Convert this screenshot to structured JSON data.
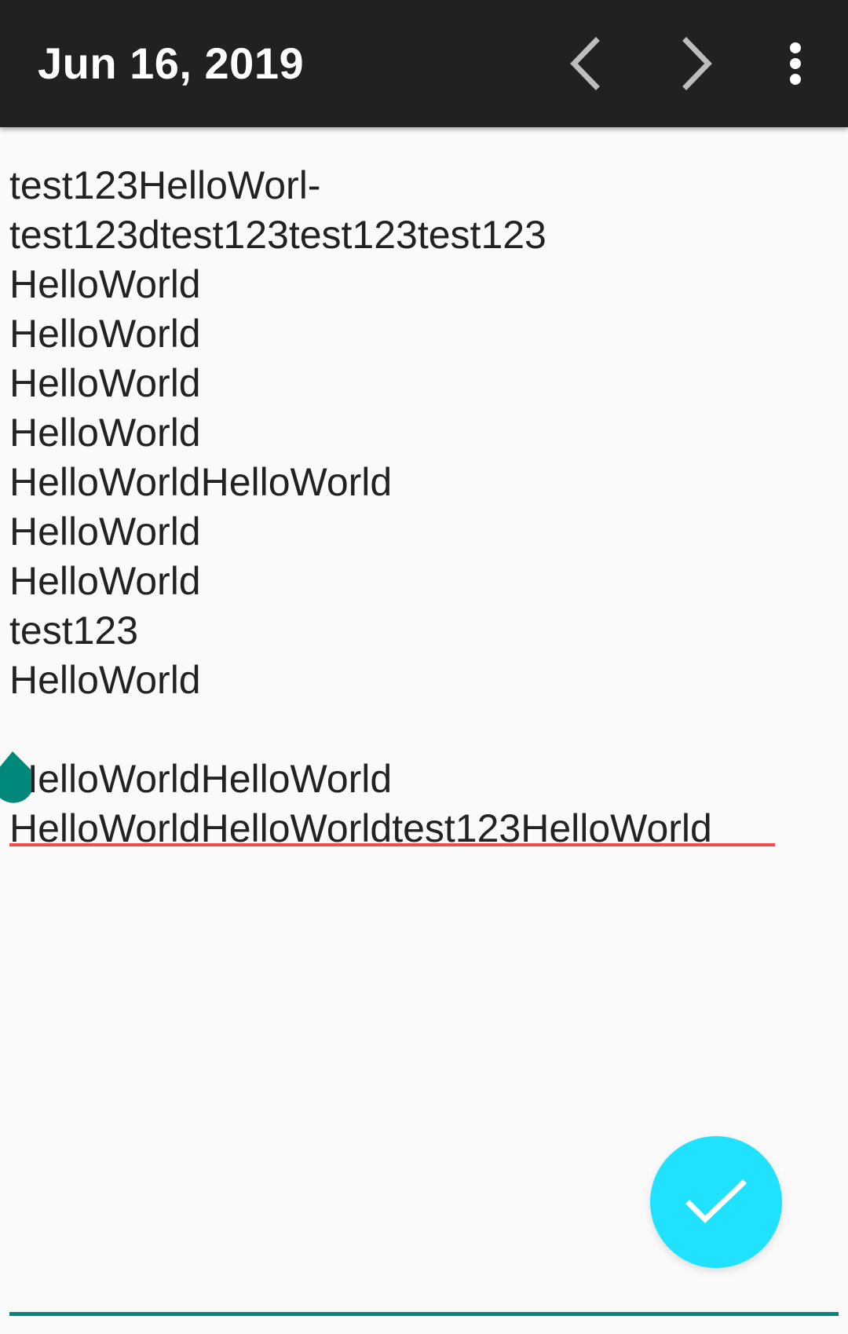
{
  "toolbar": {
    "title": "Jun 16, 2019",
    "prev_icon": "chevron-left-icon",
    "next_icon": "chevron-right-icon",
    "more_icon": "more-vert-icon"
  },
  "editor": {
    "text": "test123HelloWorl-\ntest123dtest123test123test123\nHelloWorld\nHelloWorld\nHelloWorld\nHelloWorld\nHelloWorldHelloWorld\nHelloWorld\nHelloWorld\ntest123\nHelloWorld\n\nHelloWorldHelloWorld\nHelloWorldHelloWorldtest123HelloWorld",
    "spellcheck_color": "#f44a4a",
    "cursor_handle_color": "#00897b",
    "underline_color": "#00897b"
  },
  "fab": {
    "icon": "check-icon",
    "color": "#20e2ff"
  },
  "colors": {
    "toolbar_bg": "#212121",
    "background": "#fafafa",
    "text": "#222222"
  }
}
